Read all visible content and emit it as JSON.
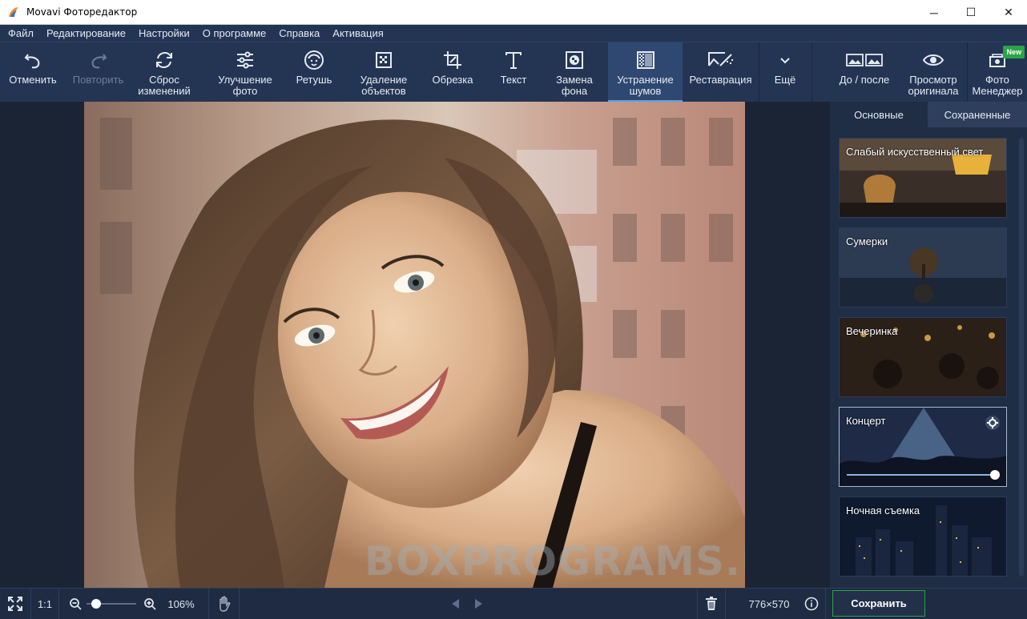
{
  "window": {
    "title": "Movavi Фоторедактор",
    "min_glyph": "─",
    "max_glyph": "☐",
    "close_glyph": "✕"
  },
  "menu": [
    "Файл",
    "Редактирование",
    "Настройки",
    "О программе",
    "Справка",
    "Активация"
  ],
  "toolbar": {
    "undo": "Отменить",
    "redo": "Повторить",
    "reset": "Сброс\nизменений",
    "enhance": "Улучшение\nфото",
    "retouch": "Ретушь",
    "remove_objects": "Удаление\nобъектов",
    "crop": "Обрезка",
    "text": "Текст",
    "replace_bg": "Замена\nфона",
    "denoise": "Устранение\nшумов",
    "restore": "Реставрация",
    "more": "Ещё",
    "before_after": "До / после",
    "view_original": "Просмотр\nоригинала",
    "photo_manager": "Фото\nМенеджер",
    "new_badge": "New"
  },
  "canvas": {
    "watermark": "BOXPROGRAMS.RU"
  },
  "panel": {
    "tabs": [
      "Основные",
      "Сохраненные"
    ],
    "presets": [
      "Слабый искусственный свет",
      "Сумерки",
      "Вечеринка",
      "Концерт",
      "Ночная съемка"
    ],
    "selected_preset": "Концерт",
    "selected_intensity": 1.0
  },
  "bottom": {
    "ratio": "1:1",
    "zoom": "106%",
    "dimensions": "776×570",
    "save": "Сохранить"
  },
  "colors": {
    "toolbar_bg": "#243554",
    "active_tool": "#2f4871",
    "accent_green": "#2aa54a"
  }
}
